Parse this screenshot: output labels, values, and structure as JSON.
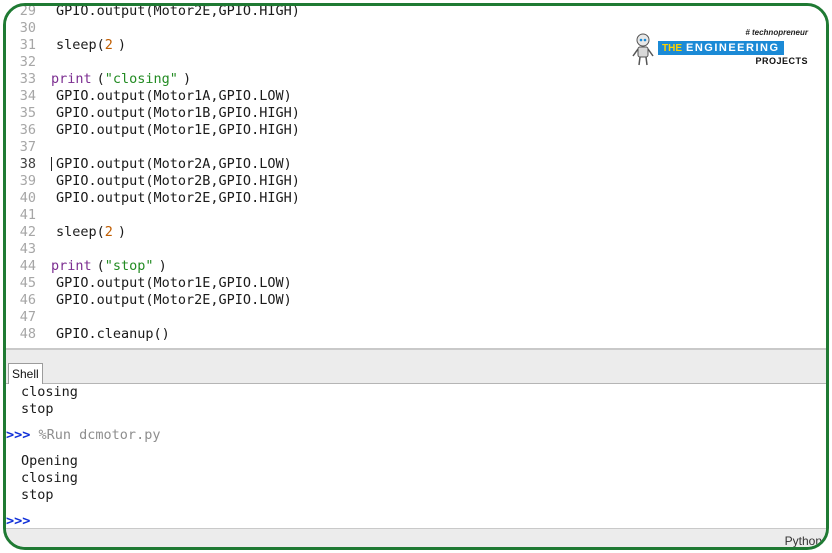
{
  "editor": {
    "lines": [
      {
        "n": "29",
        "parts": [
          {
            "c": "tx",
            "t": "GPIO.output(Motor2E,GPIO.HIGH)"
          }
        ]
      },
      {
        "n": "30",
        "parts": []
      },
      {
        "n": "31",
        "parts": [
          {
            "c": "tx",
            "t": "sleep("
          },
          {
            "c": "num",
            "t": "2"
          },
          {
            "c": "tx",
            "t": ")"
          }
        ]
      },
      {
        "n": "32",
        "parts": []
      },
      {
        "n": "33",
        "parts": [
          {
            "c": "kw",
            "t": "print"
          },
          {
            "c": "tx",
            "t": "("
          },
          {
            "c": "str",
            "t": "\"closing\""
          },
          {
            "c": "tx",
            "t": ")"
          }
        ]
      },
      {
        "n": "34",
        "parts": [
          {
            "c": "tx",
            "t": "GPIO.output(Motor1A,GPIO.LOW)"
          }
        ]
      },
      {
        "n": "35",
        "parts": [
          {
            "c": "tx",
            "t": "GPIO.output(Motor1B,GPIO.HIGH)"
          }
        ]
      },
      {
        "n": "36",
        "parts": [
          {
            "c": "tx",
            "t": "GPIO.output(Motor1E,GPIO.HIGH)"
          }
        ]
      },
      {
        "n": "37",
        "parts": []
      },
      {
        "n": "38",
        "active": true,
        "parts": [
          {
            "c": "tx",
            "t": "GPIO.output(Motor2A,GPIO.LOW)"
          }
        ]
      },
      {
        "n": "39",
        "parts": [
          {
            "c": "tx",
            "t": "GPIO.output(Motor2B,GPIO.HIGH)"
          }
        ]
      },
      {
        "n": "40",
        "parts": [
          {
            "c": "tx",
            "t": "GPIO.output(Motor2E,GPIO.HIGH)"
          }
        ]
      },
      {
        "n": "41",
        "parts": []
      },
      {
        "n": "42",
        "parts": [
          {
            "c": "tx",
            "t": "sleep("
          },
          {
            "c": "num",
            "t": "2"
          },
          {
            "c": "tx",
            "t": ")"
          }
        ]
      },
      {
        "n": "43",
        "parts": []
      },
      {
        "n": "44",
        "parts": [
          {
            "c": "kw",
            "t": "print"
          },
          {
            "c": "tx",
            "t": "("
          },
          {
            "c": "str",
            "t": "\"stop\""
          },
          {
            "c": "tx",
            "t": ")"
          }
        ]
      },
      {
        "n": "45",
        "parts": [
          {
            "c": "tx",
            "t": "GPIO.output(Motor1E,GPIO.LOW)"
          }
        ]
      },
      {
        "n": "46",
        "parts": [
          {
            "c": "tx",
            "t": "GPIO.output(Motor2E,GPIO.LOW)"
          }
        ]
      },
      {
        "n": "47",
        "parts": []
      },
      {
        "n": "48",
        "parts": [
          {
            "c": "tx",
            "t": "GPIO.cleanup()"
          }
        ]
      }
    ]
  },
  "logo": {
    "tag": "# technopreneur",
    "the": "THE",
    "engineering": "ENGINEERING",
    "projects": "PROJECTS"
  },
  "shell": {
    "tab_label": "Shell",
    "prev_output": [
      "closing",
      "stop"
    ],
    "prompt": ">>>",
    "command": "%Run dcmotor.py",
    "output": [
      "Opening",
      "closing",
      "stop"
    ],
    "final_prompt": ">>>"
  },
  "status": {
    "interpreter": "Python"
  },
  "colors": {
    "frame_border": "#1f7a33",
    "keyword": "#7c2e91",
    "string": "#228b22",
    "number": "#c05d00",
    "prompt": "#1030d8",
    "logo_band": "#1b8ad6"
  }
}
